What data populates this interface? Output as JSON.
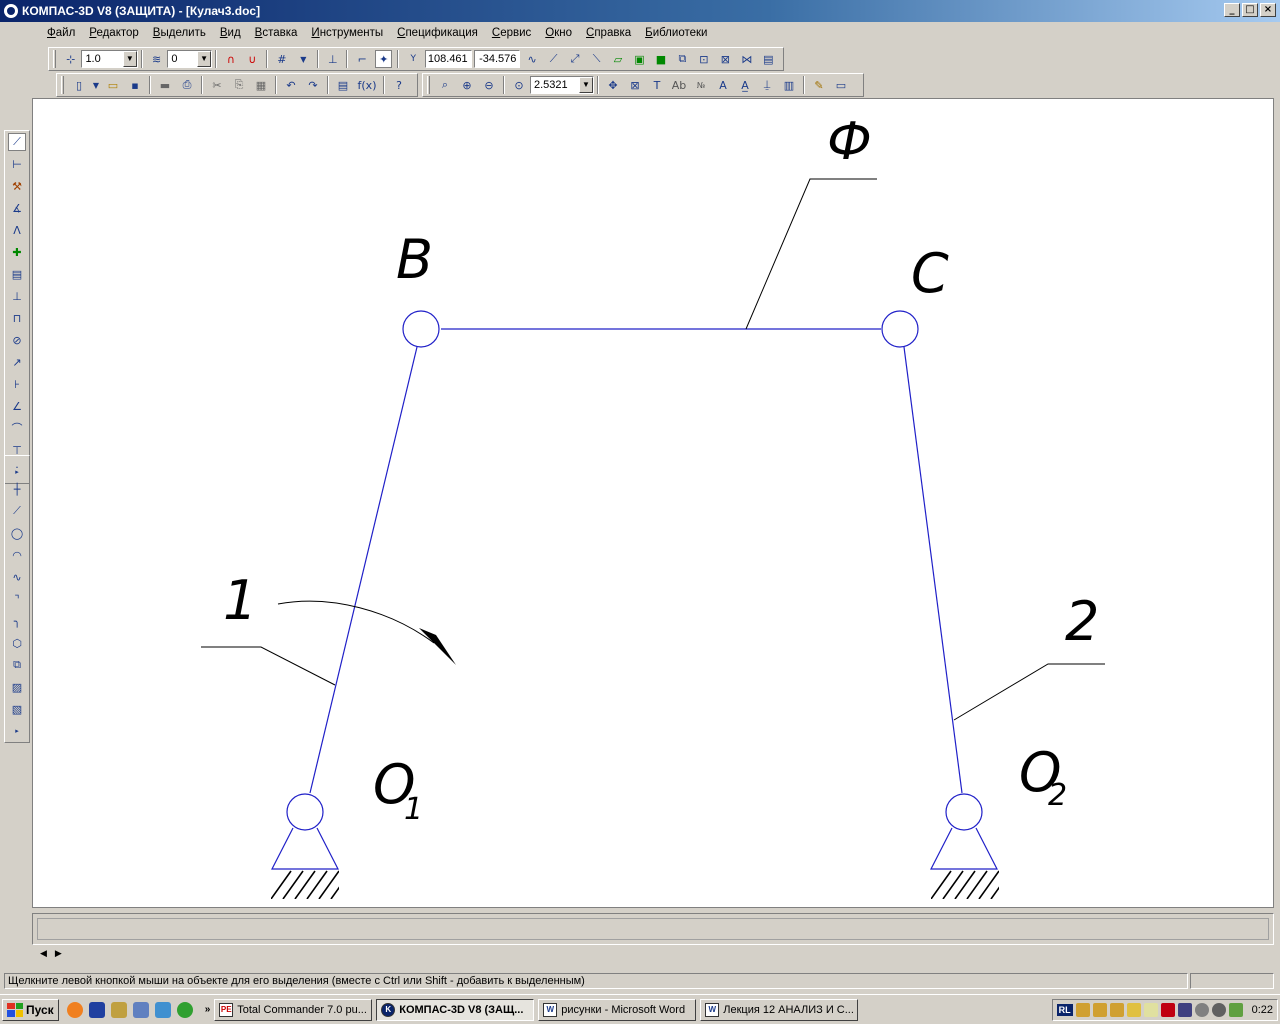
{
  "window": {
    "title": "КОМПАС-3D V8 (ЗАЩИТА) - [Кулач3.doc]",
    "buttons": [
      "_",
      "□",
      "×"
    ]
  },
  "menu": [
    "Файл",
    "Редактор",
    "Выделить",
    "Вид",
    "Вставка",
    "Инструменты",
    "Спецификация",
    "Сервис",
    "Окно",
    "Справка",
    "Библиотеки"
  ],
  "toolbar1": {
    "step_value": "1.0",
    "layer_value": "0",
    "coord_x": "108.461",
    "coord_y": "-34.576"
  },
  "toolbar2": {
    "zoom_value": "2.5321",
    "fx_label": "f(x)"
  },
  "drawing": {
    "labels": {
      "b": "B",
      "c": "C",
      "phi": "Ф",
      "link1": "1",
      "link2": "2",
      "o1_main": "O",
      "o1_sub": "1",
      "o2_main": "O",
      "o2_sub": "2"
    },
    "line_color": "#2020c8"
  },
  "status": {
    "hint": "Щелкните левой кнопкой мыши на объекте для его выделения (вместе с Ctrl или Shift - добавить к выделенным)"
  },
  "taskbar": {
    "start_label": "Пуск",
    "tasks": [
      {
        "label": "Total Commander 7.0 pu...",
        "icon": "PE"
      },
      {
        "label": "КОМПАС-3D V8 (ЗАЩ...",
        "icon": "K"
      },
      {
        "label": "рисунки - Microsoft Word",
        "icon": "W"
      },
      {
        "label": "Лекция 12 АНАЛИЗ И С...",
        "icon": "W"
      }
    ],
    "lang": "RL",
    "clock": "0:22"
  }
}
